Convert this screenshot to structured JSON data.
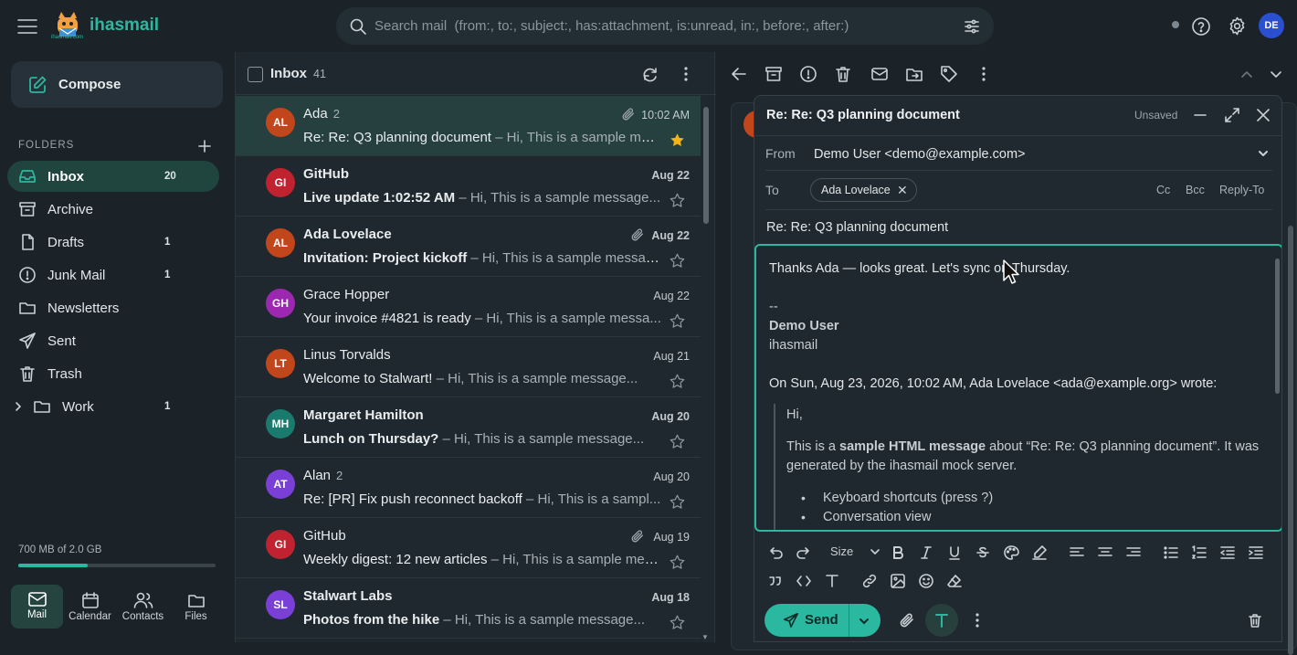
{
  "app": {
    "brand": "ihasmail",
    "logo_caption": "ihasmail.com",
    "avatar_initials": "DE"
  },
  "search": {
    "placeholder": "Search mail  (from:, to:, subject:, has:attachment, is:unread, in:, before:, after:)"
  },
  "sidebar": {
    "compose_label": "Compose",
    "folders_title": "FOLDERS",
    "folders": [
      {
        "label": "Inbox",
        "count": "20",
        "icon": "inbox-icon"
      },
      {
        "label": "Archive",
        "count": "",
        "icon": "archive-icon"
      },
      {
        "label": "Drafts",
        "count": "1",
        "icon": "drafts-icon"
      },
      {
        "label": "Junk Mail",
        "count": "1",
        "icon": "junk-icon"
      },
      {
        "label": "Newsletters",
        "count": "",
        "icon": "folder-icon"
      },
      {
        "label": "Sent",
        "count": "",
        "icon": "sent-icon"
      },
      {
        "label": "Trash",
        "count": "",
        "icon": "trash-icon"
      },
      {
        "label": "Work",
        "count": "1",
        "icon": "folder-icon"
      }
    ],
    "storage_text": "700 MB of 2.0 GB",
    "storage_fraction": 0.35,
    "nav": [
      {
        "label": "Mail"
      },
      {
        "label": "Calendar"
      },
      {
        "label": "Contacts"
      },
      {
        "label": "Files"
      }
    ]
  },
  "list": {
    "title": "Inbox",
    "count": "41",
    "messages": [
      {
        "initials": "AL",
        "color": "#c2461c",
        "from": "Ada",
        "thread_count": "2",
        "subject": "Re: Re: Q3 planning document",
        "preview": " – Hi, This is a sample mes...",
        "date": "10:02 AM",
        "unread": false,
        "starred": true,
        "attachment": true,
        "selected": true
      },
      {
        "initials": "GI",
        "color": "#c0222f",
        "from": "GitHub",
        "thread_count": "",
        "subject": "Live update 1:02:52 AM",
        "preview": " – Hi, This is a sample message...",
        "date": "Aug 22",
        "unread": true,
        "starred": false,
        "attachment": false,
        "selected": false
      },
      {
        "initials": "AL",
        "color": "#c2461c",
        "from": "Ada Lovelace",
        "thread_count": "",
        "subject": "Invitation: Project kickoff",
        "preview": " – Hi, This is a sample message...",
        "date": "Aug 22",
        "unread": true,
        "starred": false,
        "attachment": true,
        "selected": false
      },
      {
        "initials": "GH",
        "color": "#9c27b0",
        "from": "Grace Hopper",
        "thread_count": "",
        "subject": "Your invoice #4821 is ready",
        "preview": " – Hi, This is a sample messa...",
        "date": "Aug 22",
        "unread": false,
        "starred": false,
        "attachment": false,
        "selected": false
      },
      {
        "initials": "LT",
        "color": "#c2461c",
        "from": "Linus Torvalds",
        "thread_count": "",
        "subject": "Welcome to Stalwart!",
        "preview": " – Hi, This is a sample message...",
        "date": "Aug 21",
        "unread": false,
        "starred": false,
        "attachment": false,
        "selected": false
      },
      {
        "initials": "MH",
        "color": "#1b7a6e",
        "from": "Margaret Hamilton",
        "thread_count": "",
        "subject": "Lunch on Thursday?",
        "preview": " – Hi, This is a sample message...",
        "date": "Aug 20",
        "unread": true,
        "starred": false,
        "attachment": false,
        "selected": false
      },
      {
        "initials": "AT",
        "color": "#7a3fd6",
        "from": "Alan",
        "thread_count": "2",
        "subject": "Re: [PR] Fix push reconnect backoff",
        "preview": " – Hi, This is a sampl...",
        "date": "Aug 20",
        "unread": false,
        "starred": false,
        "attachment": false,
        "selected": false
      },
      {
        "initials": "GI",
        "color": "#c0222f",
        "from": "GitHub",
        "thread_count": "",
        "subject": "Weekly digest: 12 new articles",
        "preview": " – Hi, This is a sample mes...",
        "date": "Aug 19",
        "unread": false,
        "starred": false,
        "attachment": true,
        "selected": false
      },
      {
        "initials": "SL",
        "color": "#7a3fd6",
        "from": "Stalwart Labs",
        "thread_count": "",
        "subject": "Photos from the hike",
        "preview": " – Hi, This is a sample message...",
        "date": "Aug 18",
        "unread": true,
        "starred": false,
        "attachment": false,
        "selected": false
      }
    ]
  },
  "composer": {
    "title": "Re: Re: Q3 planning document",
    "status": "Unsaved",
    "from_label": "From",
    "from_value": "Demo User <demo@example.com>",
    "to_label": "To",
    "to_chip": "Ada Lovelace",
    "cc": "Cc",
    "bcc": "Bcc",
    "reply_to": "Reply-To",
    "subject": "Re: Re: Q3 planning document",
    "body_line": "Thanks Ada — looks great. Let's sync on Thursday.",
    "sig_sep": "--",
    "sig_name": "Demo User",
    "sig_org": "ihasmail",
    "quote_header": "On Sun, Aug 23, 2026, 10:02 AM, Ada Lovelace <ada@example.org> wrote:",
    "quote_hi": "Hi,",
    "quote_p1a": "This is a ",
    "quote_p1b": "sample HTML message",
    "quote_p1c": " about “Re: Re: Q3 planning document”. It was",
    "quote_p2": "generated by the ihasmail mock server.",
    "quote_li1": "Keyboard shortcuts (press ?)",
    "quote_li2": "Conversation view",
    "size_label": "Size",
    "send_label": "Send"
  }
}
